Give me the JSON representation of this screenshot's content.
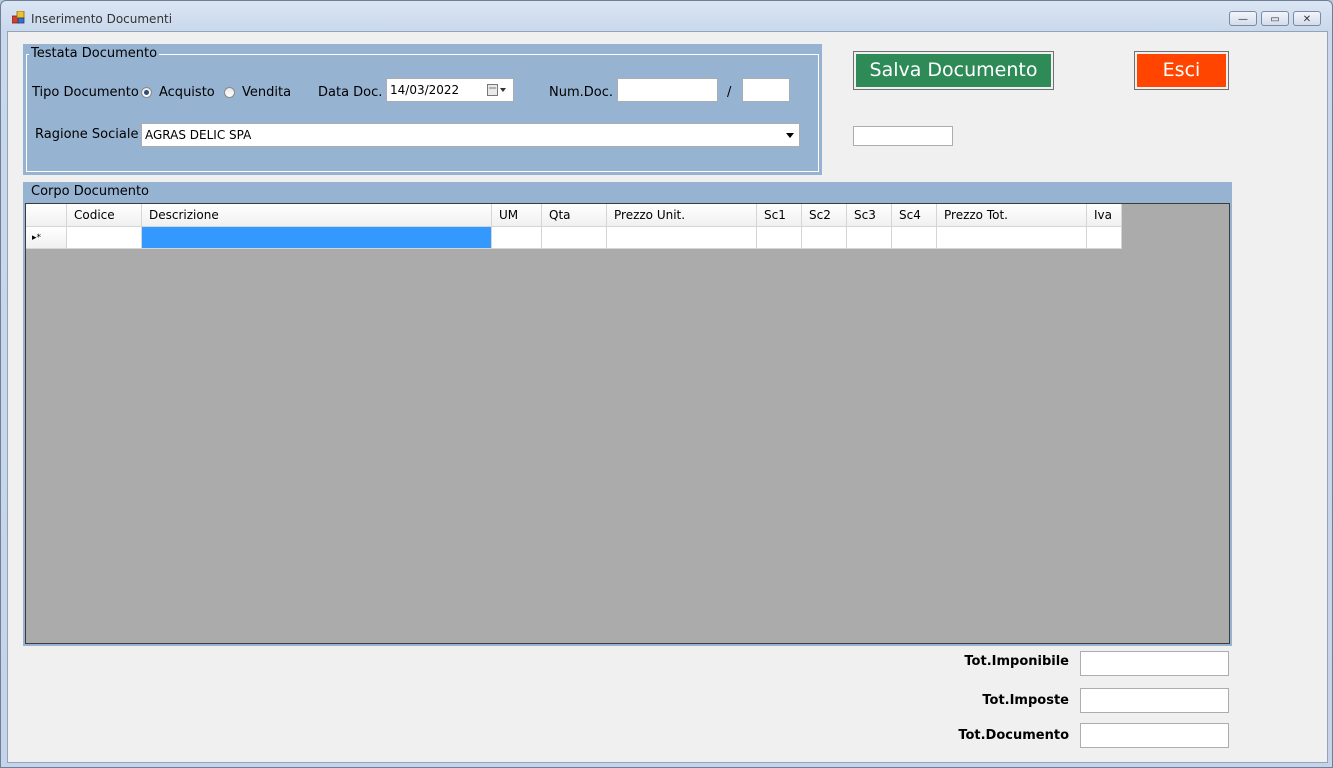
{
  "window": {
    "title": "Inserimento Documenti",
    "minimize": "—",
    "maximize": "▭",
    "close": "✕"
  },
  "header_group": {
    "title": "Testata Documento",
    "tipo_label": "Tipo Documento",
    "radio_acquisto": "Acquisto",
    "radio_vendita": "Vendita",
    "selected": "Acquisto",
    "data_label": "Data Doc.",
    "data_value": "14/03/2022",
    "num_label": "Num.Doc.",
    "num_sep": "/",
    "num_value": "",
    "num_suffix": "",
    "ragione_label": "Ragione Sociale",
    "ragione_value": "AGRAS DELIC SPA"
  },
  "buttons": {
    "salva": "Salva Documento",
    "salva_color": "#2e8b57",
    "esci": "Esci",
    "esci_color": "#ff4500"
  },
  "status_field": "",
  "body_group": {
    "title": "Corpo Documento",
    "columns": [
      "Codice",
      "Descrizione",
      "UM",
      "Qta",
      "Prezzo Unit.",
      "Sc1",
      "Sc2",
      "Sc3",
      "Sc4",
      "Prezzo Tot.",
      "Iva"
    ],
    "new_row_marker": "▸*"
  },
  "totals": {
    "imponibile_label": "Tot.Imponibile",
    "imposte_label": "Tot.Imposte",
    "documento_label": "Tot.Documento",
    "imponibile_value": "",
    "imposte_value": "",
    "documento_value": ""
  }
}
